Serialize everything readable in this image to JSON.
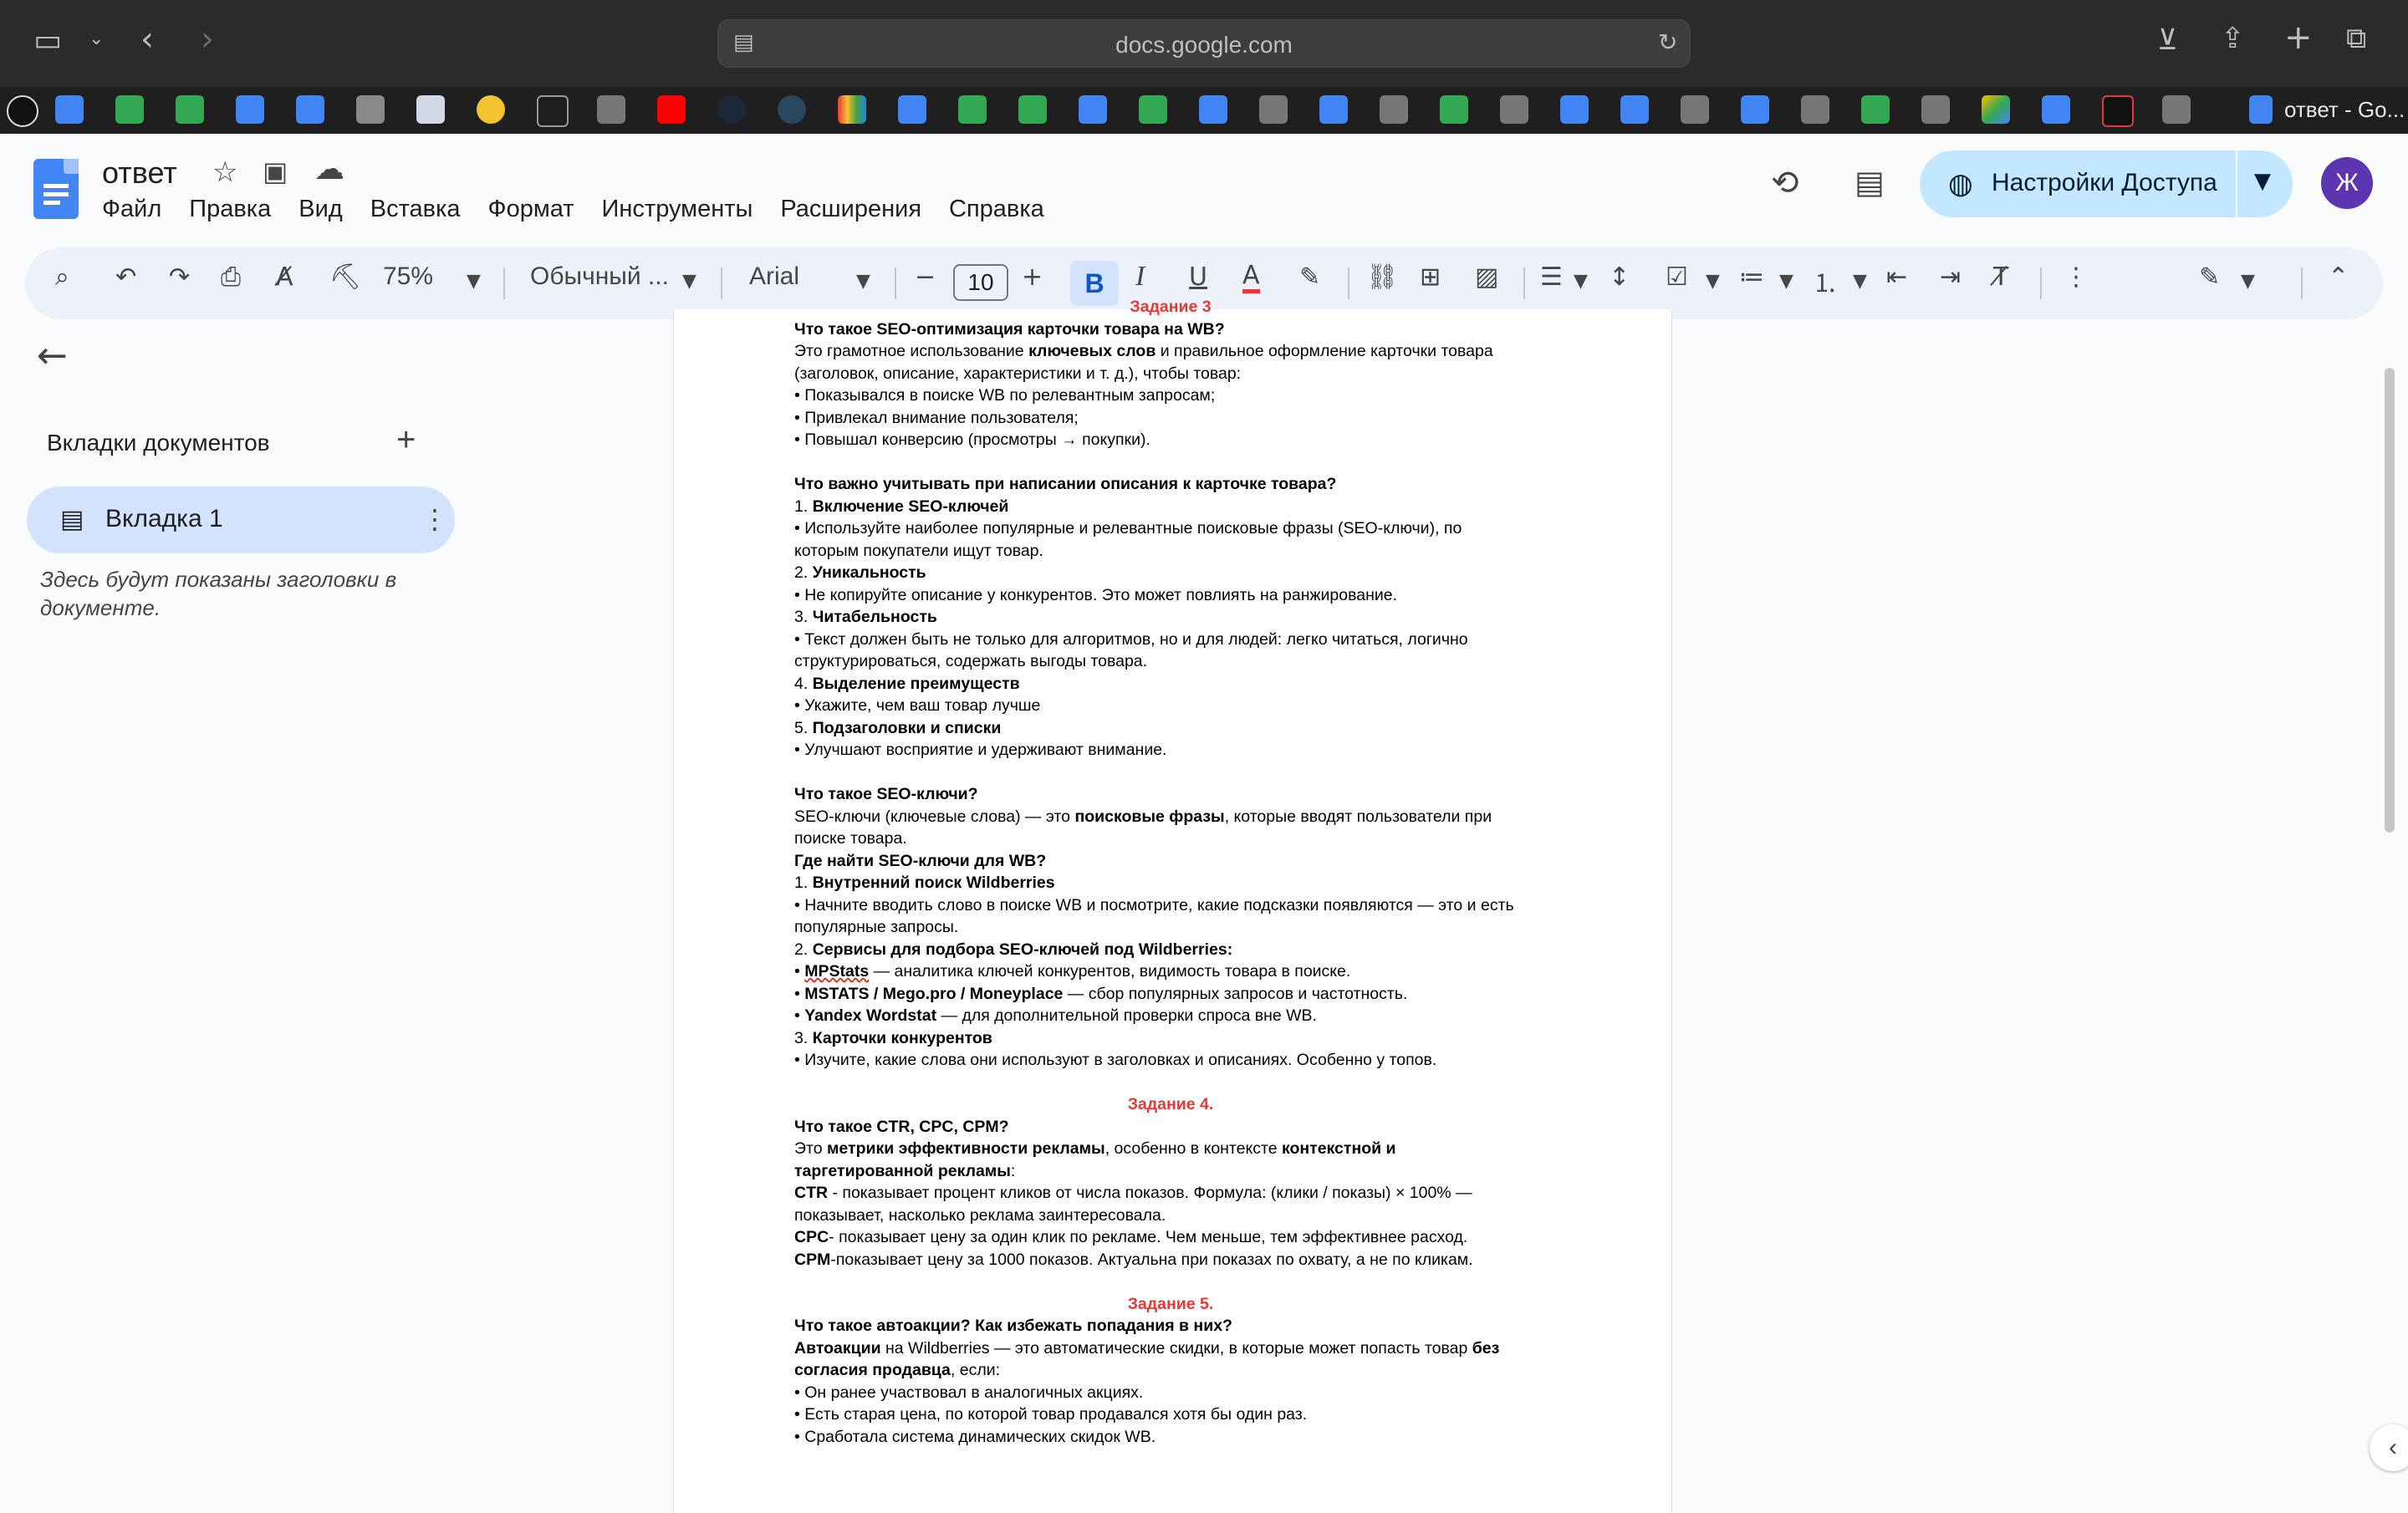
{
  "browser": {
    "url": "docs.google.com",
    "tab_title": "ответ - Go..."
  },
  "doc": {
    "title": "ответ",
    "menu": [
      "Файл",
      "Правка",
      "Вид",
      "Вставка",
      "Формат",
      "Инструменты",
      "Расширения",
      "Справка"
    ],
    "share_label": "Настройки Доступа",
    "avatar_letter": "Ж"
  },
  "toolbar": {
    "zoom": "75%",
    "style": "Обычный ...",
    "font": "Arial",
    "font_size": "10",
    "bold": "B",
    "italic": "I",
    "underline": "U",
    "text_color": "A"
  },
  "sidebar": {
    "heading": "Вкладки документов",
    "tab_label": "Вкладка 1",
    "note": "Здесь будут показаны заголовки в документе."
  },
  "content": {
    "z3_title": "Задание 3",
    "z3_q1": "Что такое SEO-оптимизация карточки товара на WB?",
    "z3_l1a": "Это грамотное использование ",
    "z3_l1b": "ключевых слов",
    "z3_l1c": " и правильное оформление карточки товара",
    "z3_l2": "(заголовок, описание, характеристики и т. д.), чтобы товар:",
    "z3_l3": " • Показывался в поиске WB по релевантным запросам;",
    "z3_l4": " • Привлекал внимание пользователя;",
    "z3_l5": " • Повышал конверсию (просмотры → покупки).",
    "z3_q2": "Что важно учитывать при написании описания к карточке товара?",
    "z3_i1n": " 1. ",
    "z3_i1": "Включение SEO-ключей",
    "z3_i1d1": " • Используйте наиболее популярные и релевантные поисковые фразы (SEO-ключи), по",
    "z3_i1d2": "которым покупатели ищут товар.",
    "z3_i2n": " 2. ",
    "z3_i2": "Уникальность",
    "z3_i2d": " • Не копируйте описание у конкурентов. Это может повлиять на ранжирование.",
    "z3_i3n": " 3. ",
    "z3_i3": "Читабельность",
    "z3_i3d1": " • Текст должен быть не только для алгоритмов, но и для людей: легко читаться, логично",
    "z3_i3d2": "структурироваться, содержать выгоды товара.",
    "z3_i4n": " 4. ",
    "z3_i4": "Выделение преимуществ",
    "z3_i4d": " • Укажите, чем ваш товар лучше",
    "z3_i5n": " 5. ",
    "z3_i5": "Подзаголовки и списки",
    "z3_i5d": " • Улучшают восприятие и удерживают внимание.",
    "z3_q3": "Что такое SEO-ключи?",
    "z3_k1a": "SEO-ключи (ключевые слова) — это ",
    "z3_k1b": "поисковые фразы",
    "z3_k1c": ", которые вводят пользователи при",
    "z3_k2": "поиске товара.",
    "z3_q4": "Где найти SEO-ключи для WB?",
    "z3_w1n": " 1. ",
    "z3_w1": "Внутренний поиск Wildberries",
    "z3_w1d1": " • Начните вводить слово в поиске WB и посмотрите, какие подсказки появляются — это и есть",
    "z3_w1d2": "популярные запросы.",
    "z3_w2n": " 2. ",
    "z3_w2": "Сервисы для подбора SEO-ключей под Wildberries:",
    "z3_s1p": " • ",
    "z3_s1b": "MPStats",
    "z3_s1t": " — аналитика ключей конкурентов, видимость товара в поиске.",
    "z3_s2p": " • ",
    "z3_s2b": "MSTATS / Mego.pro / Moneyplace",
    "z3_s2t": " — сбор популярных запросов и частотность.",
    "z3_s3p": " • ",
    "z3_s3b": "Yandex Wordstat",
    "z3_s3t": " — для дополнительной проверки спроса вне WB.",
    "z3_w3n": " 3. ",
    "z3_w3": "Карточки конкурентов",
    "z3_w3d": " • Изучите, какие слова они используют в заголовках и описаниях. Особенно у топов.",
    "z4_title": "Задание 4.",
    "z4_q": " Что такое CTR, CPC, CPM?",
    "z4_l1a": "Это ",
    "z4_l1b": "метрики эффективности рекламы",
    "z4_l1c": ", особенно в контексте ",
    "z4_l1d": "контекстной и",
    "z4_l2b": "таргетированной рекламы",
    "z4_l2c": ":",
    "z4_ctr_b": "CTR",
    "z4_ctr_t": " - показывает процент кликов от числа показов. Формула: (клики / показы) × 100% —",
    "z4_ctr_t2": "показывает, насколько реклама заинтересовала.",
    "z4_cpc_b": "CPC",
    "z4_cpc_t": "- показывает цену за один клик по рекламе. Чем меньше, тем эффективнее расход.",
    "z4_cpm_b": "CPM",
    "z4_cpm_t": "-показывает цену  за 1000 показов. Актуальна при показах по охвату, а не по кликам.",
    "z5_title": "Задание 5.",
    "z5_q": "Что такое автоакции? Как избежать попадания в них?",
    "z5_l1b": "Автоакции",
    "z5_l1t": " на Wildberries — это автоматические скидки, в которые может попасть товар ",
    "z5_l1b2": "без",
    "z5_l2b": "согласия продавца",
    "z5_l2t": ", если:",
    "z5_b1": " • Он ранее участвовал в аналогичных акциях.",
    "z5_b2": " • Есть старая цена, по которой товар продавался хотя бы один раз.",
    "z5_b3": " • Сработала система динамических скидок WB."
  },
  "icons": [
    "sidebar-icon",
    "chevron-down-icon",
    "back-icon",
    "forward-icon",
    "reader-icon",
    "reload-icon",
    "download-icon",
    "share-icon",
    "plus-icon",
    "tabs-icon",
    "star-icon",
    "move-icon",
    "cloud-icon",
    "history-icon",
    "comment-icon",
    "globe-icon",
    "search-icon",
    "undo-icon",
    "redo-icon",
    "print-icon",
    "spellcheck-icon",
    "paint-format-icon",
    "link-icon",
    "add-comment-icon",
    "image-icon",
    "align-icon",
    "line-spacing-icon",
    "checklist-icon",
    "bullet-list-icon",
    "numbered-list-icon",
    "indent-decrease-icon",
    "indent-increase-icon",
    "clear-format-icon",
    "more-icon",
    "edit-mode-icon",
    "collapse-icon"
  ],
  "colors": {
    "accent": "#0b57d0",
    "share_bg": "#c2e7ff",
    "heading_red": "#e53935",
    "avatar": "#5e35b1"
  }
}
